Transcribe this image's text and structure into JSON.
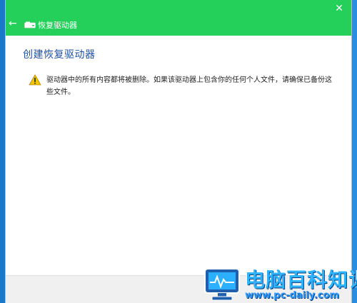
{
  "window": {
    "title": "恢复驱动器",
    "close_glyph": "✕",
    "back_glyph": "←"
  },
  "main": {
    "heading": "创建恢复驱动器",
    "warning_text": "驱动器中的所有内容都将被删除。如果该驱动器上包含你的任何个人文件，请确保已备份这些文件。"
  },
  "watermark": {
    "title": "电脑百科知识",
    "url": "www.pc-daily.com"
  },
  "colors": {
    "titlebar": "#24d05a",
    "heading": "#1f4f9f",
    "desktop": "#1b78c8",
    "warning_yellow": "#f5c400"
  },
  "icons": {
    "drive": "drive-icon",
    "warning": "warning-icon",
    "close": "close-icon",
    "back": "back-arrow-icon"
  }
}
